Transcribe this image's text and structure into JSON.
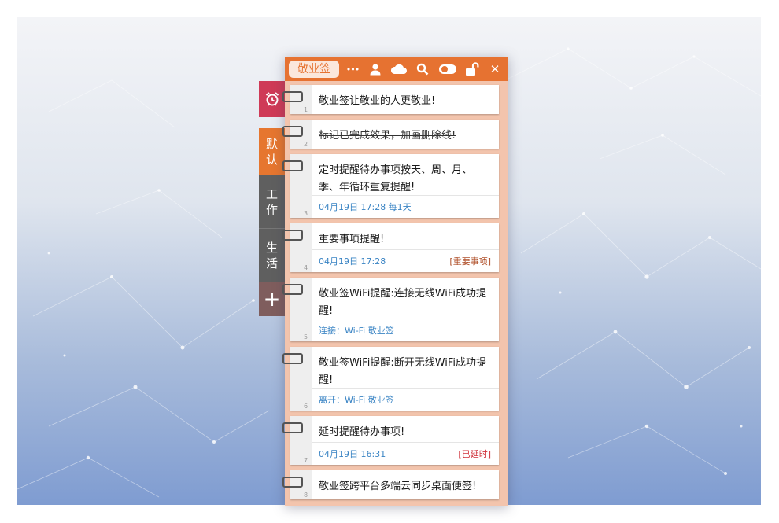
{
  "app": {
    "title": "敬业签"
  },
  "toolbar": {
    "icons": [
      "more-icon",
      "user-icon",
      "cloud-icon",
      "search-icon",
      "toggle-icon",
      "unlock-icon",
      "close-icon"
    ],
    "close_glyph": "✕",
    "more_glyph": "•••"
  },
  "categories": {
    "alarm": {
      "icon": "alarm-clock-icon"
    },
    "default": {
      "label_1": "默",
      "label_2": "认"
    },
    "work": {
      "label_1": "工",
      "label_2": "作"
    },
    "life": {
      "label_1": "生",
      "label_2": "活"
    },
    "add": {
      "glyph": "+"
    }
  },
  "notes": [
    {
      "num": "1",
      "text": "敬业签让敬业的人更敬业!"
    },
    {
      "num": "2",
      "text": "标记已完成效果，加画删除线!"
    },
    {
      "num": "3",
      "text": "定时提醒待办事项按天、周、月、季、年循环重复提醒!",
      "meta": "04月19日 17:28 每1天"
    },
    {
      "num": "4",
      "text": "重要事项提醒!",
      "meta": "04月19日 17:28",
      "tag": "[重要事项]"
    },
    {
      "num": "5",
      "text": "敬业签WiFi提醒:连接无线WiFi成功提醒!",
      "meta": "连接：Wi-Fi 敬业签"
    },
    {
      "num": "6",
      "text": "敬业签WiFi提醒:断开无线WiFi成功提醒!",
      "meta": "离开：Wi-Fi 敬业签"
    },
    {
      "num": "7",
      "text": "延时提醒待办事项!",
      "meta": "04月19日 16:31",
      "tag": "[已延时]"
    },
    {
      "num": "8",
      "text": "敬业签跨平台多端云同步桌面便签!"
    }
  ],
  "colors": {
    "accent": "#e67231",
    "important_tag": "#b0502a",
    "delayed_tag": "#d0313a",
    "meta_blue": "#3a84c4",
    "alarm_tab": "#cf3a57"
  }
}
